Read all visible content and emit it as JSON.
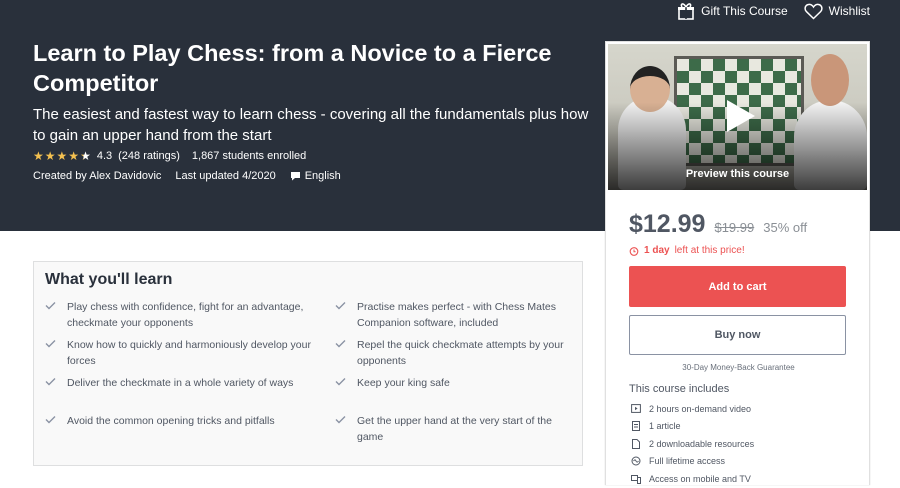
{
  "topbar": {
    "gift_label": "Gift This Course",
    "wishlist_label": "Wishlist"
  },
  "course": {
    "title": "Learn to Play Chess: from a Novice to a Fierce Competitor",
    "subtitle": "The easiest and fastest way to learn chess - covering all the fundamentals plus how to gain an upper hand from the start",
    "rating_value": "4.3",
    "rating_count": "(248 ratings)",
    "rating_fraction": 0.86,
    "students": "1,867 students enrolled",
    "created_by": "Created by Alex Davidovic",
    "last_updated": "Last updated 4/2020",
    "language": "English"
  },
  "card": {
    "preview_label": "Preview this course",
    "price": "$12.99",
    "original_price": "$19.99",
    "discount": "35% off",
    "time_left_bold": "1 day",
    "time_left_rest": "left at this price!",
    "add_to_cart": "Add to cart",
    "buy_now": "Buy now",
    "guarantee": "30-Day Money-Back Guarantee",
    "includes_title": "This course includes",
    "includes": [
      {
        "icon": "video-icon",
        "text": "2 hours on-demand video"
      },
      {
        "icon": "article-icon",
        "text": "1 article"
      },
      {
        "icon": "file-icon",
        "text": "2 downloadable resources"
      },
      {
        "icon": "infinity-icon",
        "text": "Full lifetime access"
      },
      {
        "icon": "mobile-tv-icon",
        "text": "Access on mobile and TV"
      }
    ]
  },
  "learn": {
    "heading": "What you'll learn",
    "items": [
      "Play chess with confidence, fight for an advantage, checkmate your opponents",
      "Practise makes perfect - with Chess Mates Companion software, included",
      "Know how to quickly and harmoniously develop your forces",
      "Repel the quick checkmate attempts by your opponents",
      "Deliver the checkmate in a whole variety of ways",
      "Keep your king safe",
      "Avoid the common opening tricks and pitfalls",
      "Get the upper hand at the very start of the game"
    ]
  },
  "colors": {
    "hero_bg": "#29303b",
    "accent_red": "#ec5252",
    "star": "#f4c150"
  }
}
